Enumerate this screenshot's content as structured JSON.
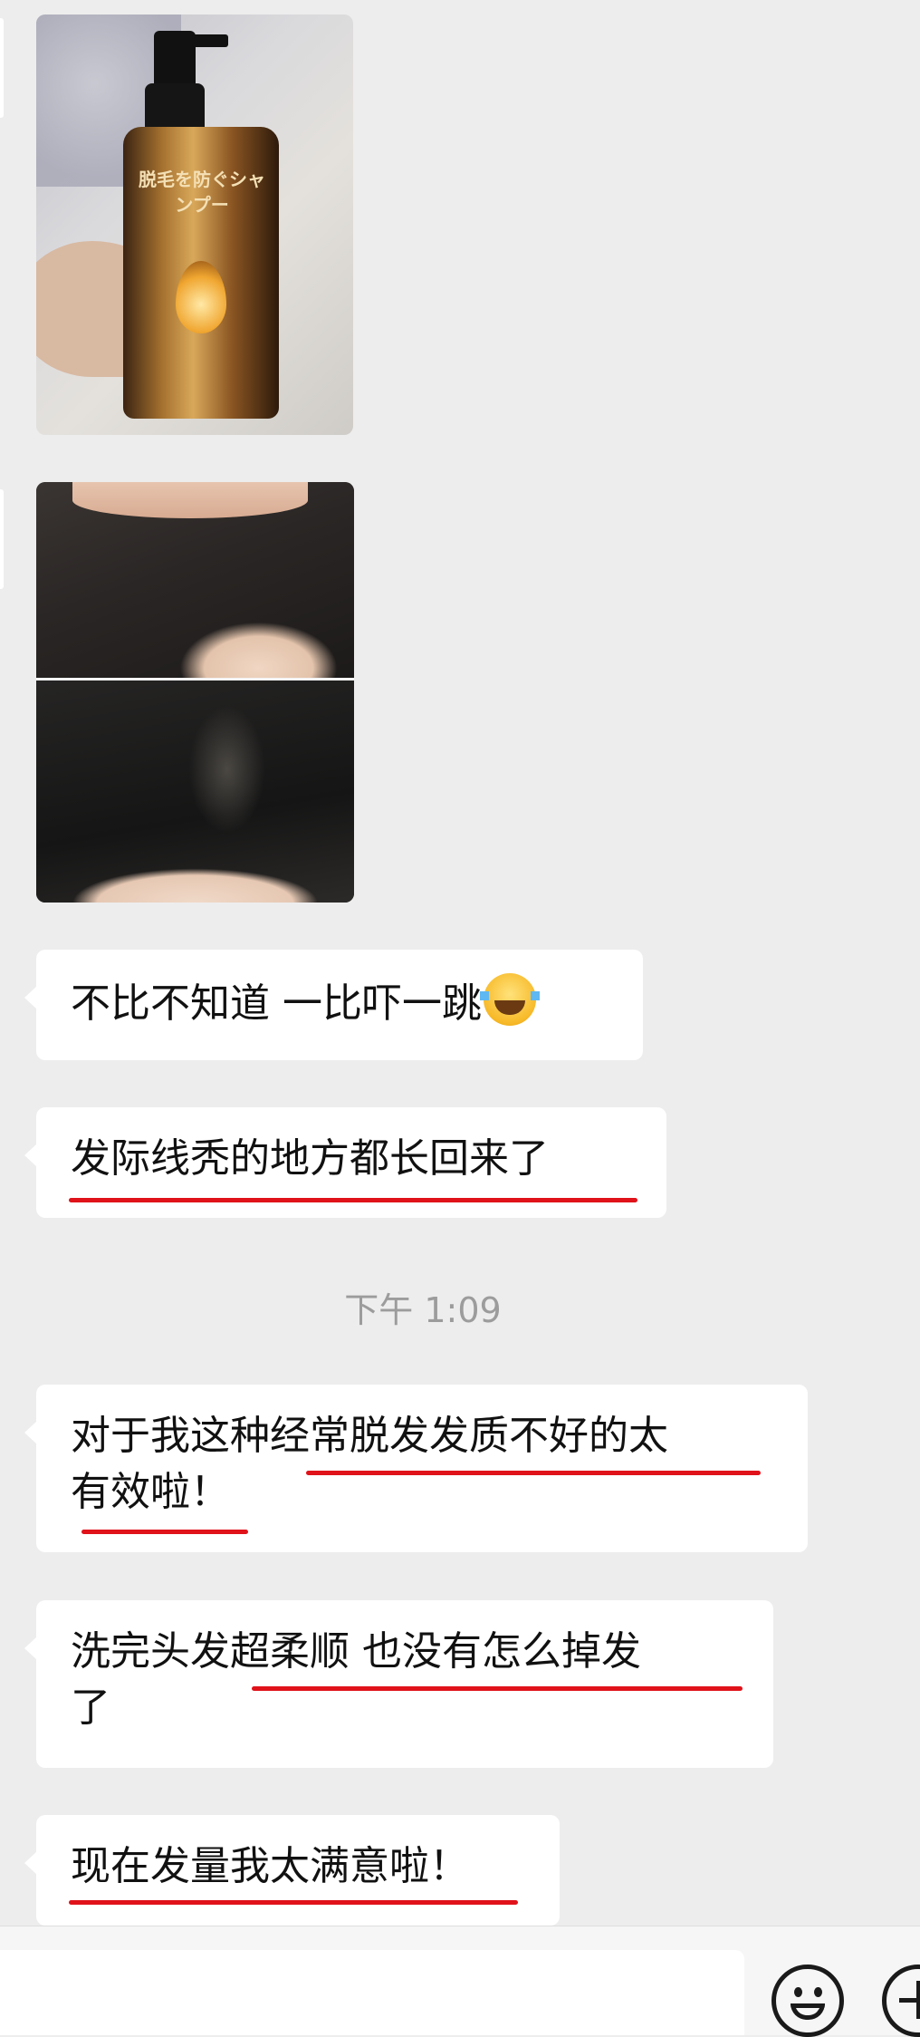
{
  "chat": {
    "messages": [
      {
        "type": "image",
        "content": "shampoo-bottle-photo",
        "label": "脱毛を防ぐシャンプー"
      },
      {
        "type": "image",
        "content": "hairline-comparison-photo"
      },
      {
        "type": "text",
        "text": "不比不知道 一比吓一跳",
        "emoji": "tears-of-joy-emoji"
      },
      {
        "type": "text",
        "text": "发际线秃的地方都长回来了"
      },
      {
        "type": "text",
        "text": "对于我这种经常脱发发质不好的太\n有效啦！"
      },
      {
        "type": "text",
        "text": "洗完头发超柔顺 也没有怎么掉发\n了"
      },
      {
        "type": "text",
        "text": "现在发量我太满意啦！"
      }
    ],
    "timestamp": "下午 1:09",
    "highlight_color": "#e0121a"
  },
  "input_bar": {
    "placeholder": "",
    "emoji_button_icon": "smiley-icon",
    "more_button_icon": "plus-icon"
  },
  "colors": {
    "background": "#ededed",
    "bubble": "#ffffff"
  }
}
